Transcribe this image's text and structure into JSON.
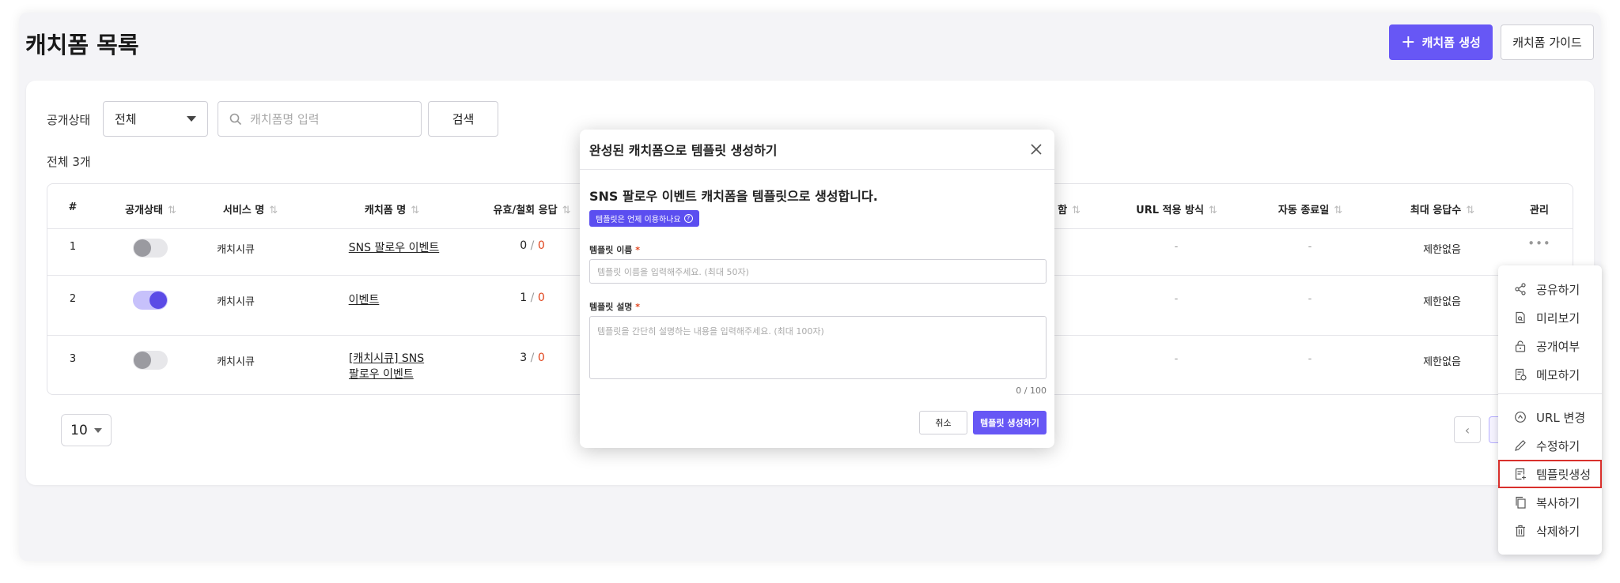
{
  "page": {
    "title": "캐치폼 목록"
  },
  "header": {
    "create_button": "캐치폼 생성",
    "create_plus": "+",
    "guide_button": "캐치폼 가이드"
  },
  "filter": {
    "status_label": "공개상태",
    "status_value": "전체",
    "search_placeholder": "캐치폼명 입력",
    "search_button": "검색",
    "total_text": "전체 3개"
  },
  "table": {
    "headers": [
      "#",
      "공개상태",
      "서비스 명",
      "캐치폼 명",
      "유효/철회 응답",
      "함",
      "URL 적용 방식",
      "자동 종료일",
      "최대 응답수",
      "관리"
    ],
    "sort_glyph": "⇅",
    "rows": [
      {
        "num": "1",
        "public": false,
        "service": "캐치시큐",
        "form_name_lines": [
          "SNS 팔로우 이벤트"
        ],
        "valid": "0",
        "slash": "/",
        "revoked": "0",
        "url_method": "-",
        "auto_end": "-",
        "max": "제한없음",
        "manage": "•••"
      },
      {
        "num": "2",
        "public": true,
        "service": "캐치시큐",
        "form_name_lines": [
          "이벤트"
        ],
        "valid": "1",
        "slash": "/",
        "revoked": "0",
        "url_method": "-",
        "auto_end": "-",
        "max": "제한없음"
      },
      {
        "num": "3",
        "public": false,
        "service": "캐치시큐",
        "form_name_lines": [
          "[캐치시큐] SNS",
          "팔로우 이벤트"
        ],
        "valid": "3",
        "slash": "/",
        "revoked": "0",
        "url_method": "-",
        "auto_end": "-",
        "max": "제한없음"
      }
    ]
  },
  "pagination": {
    "page_size": "10",
    "prev": "‹"
  },
  "context_menu": {
    "items": [
      {
        "label": "공유하기",
        "icon": "share-icon"
      },
      {
        "label": "미리보기",
        "icon": "preview-icon"
      },
      {
        "label": "공개여부",
        "icon": "lock-icon"
      },
      {
        "label": "메모하기",
        "icon": "memo-icon"
      },
      {
        "label": "URL 변경",
        "icon": "url-change-icon"
      },
      {
        "label": "수정하기",
        "icon": "pencil-icon"
      },
      {
        "label": "템플릿생성",
        "icon": "template-add-icon",
        "highlighted": true
      },
      {
        "label": "복사하기",
        "icon": "copy-icon"
      },
      {
        "label": "삭제하기",
        "icon": "trash-icon"
      }
    ]
  },
  "modal": {
    "title": "완성된 캐치폼으로 템플릿 생성하기",
    "heading": "SNS 팔로우 이벤트 캐치폼을 템플릿으로 생성합니다.",
    "help_chip": "템플릿은 언제 이용하나요",
    "help_icon": "?",
    "name_label": "템플릿 이름",
    "desc_label": "템플릿 설명",
    "required_mark": "*",
    "name_placeholder": "템플릿 이름을 입력해주세요. (최대 50자)",
    "desc_placeholder": "템플릿을 간단히 설명하는 내용을 입력해주세요. (최대 100자)",
    "counter": "0 / 100",
    "cancel": "취소",
    "submit": "템플릿 생성하기"
  },
  "colors": {
    "accent": "#6757f5",
    "danger": "#e0431b",
    "highlight_border": "#d9302c"
  }
}
